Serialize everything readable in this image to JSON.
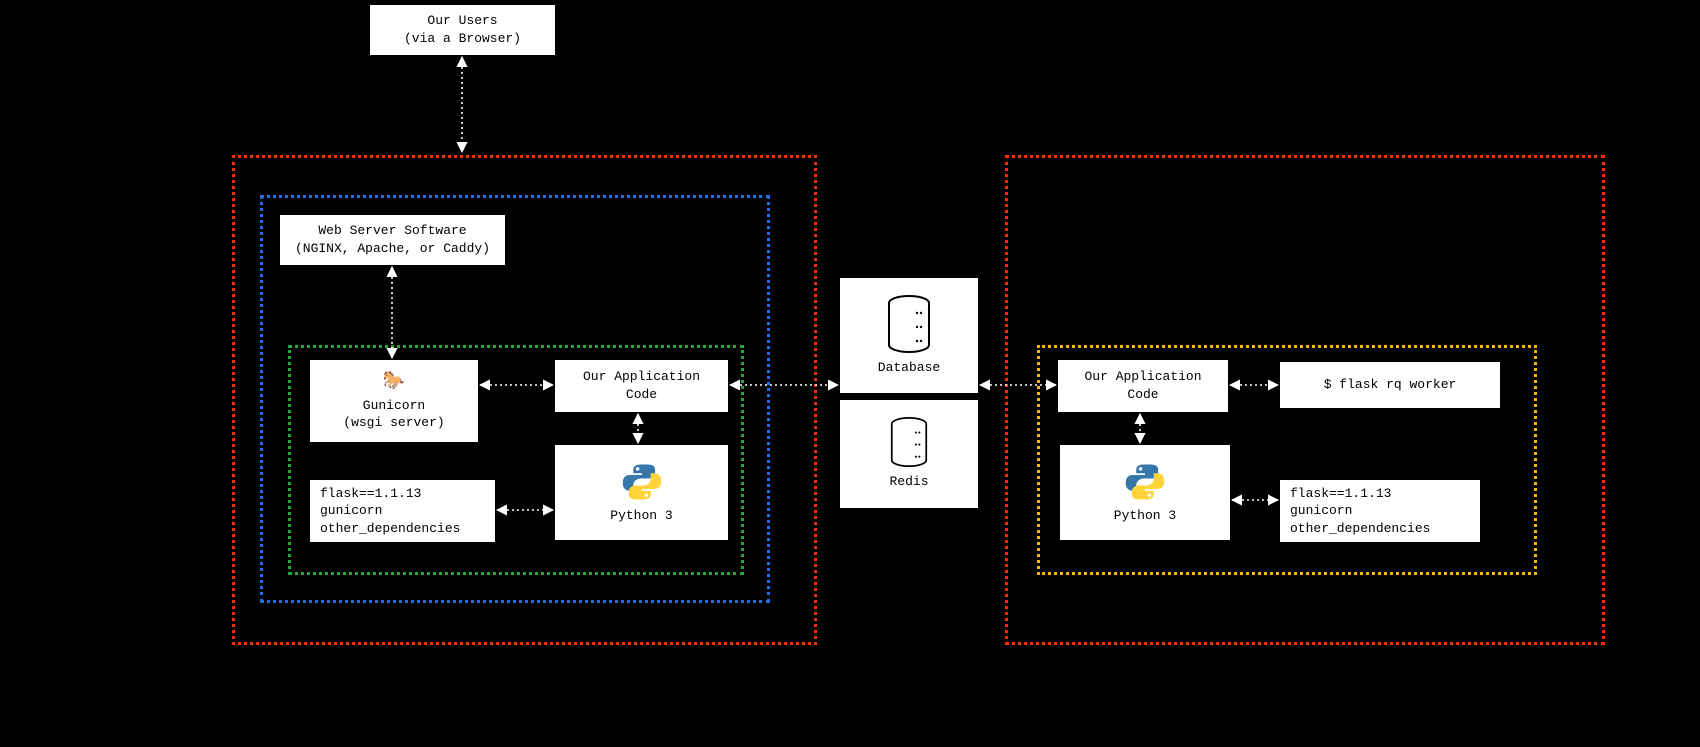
{
  "users": {
    "line1": "Our Users",
    "line2": "(via a Browser)"
  },
  "webserver": {
    "line1": "Web Server Software",
    "line2": "(NGINX, Apache, or Caddy)"
  },
  "gunicorn": {
    "line1": "Gunicorn",
    "line2": "(wsgi server)"
  },
  "appcode_left": "Our Application\nCode",
  "python_left": "Python 3",
  "deps_left": {
    "line1": "flask==1.1.13",
    "line2": "gunicorn",
    "line3": "other_dependencies"
  },
  "database": "Database",
  "redis": "Redis",
  "appcode_right": "Our Application\nCode",
  "worker_cmd": "$ flask rq worker",
  "python_right": "Python 3",
  "deps_right": {
    "line1": "flask==1.1.13",
    "line2": "gunicorn",
    "line3": "other_dependencies"
  }
}
